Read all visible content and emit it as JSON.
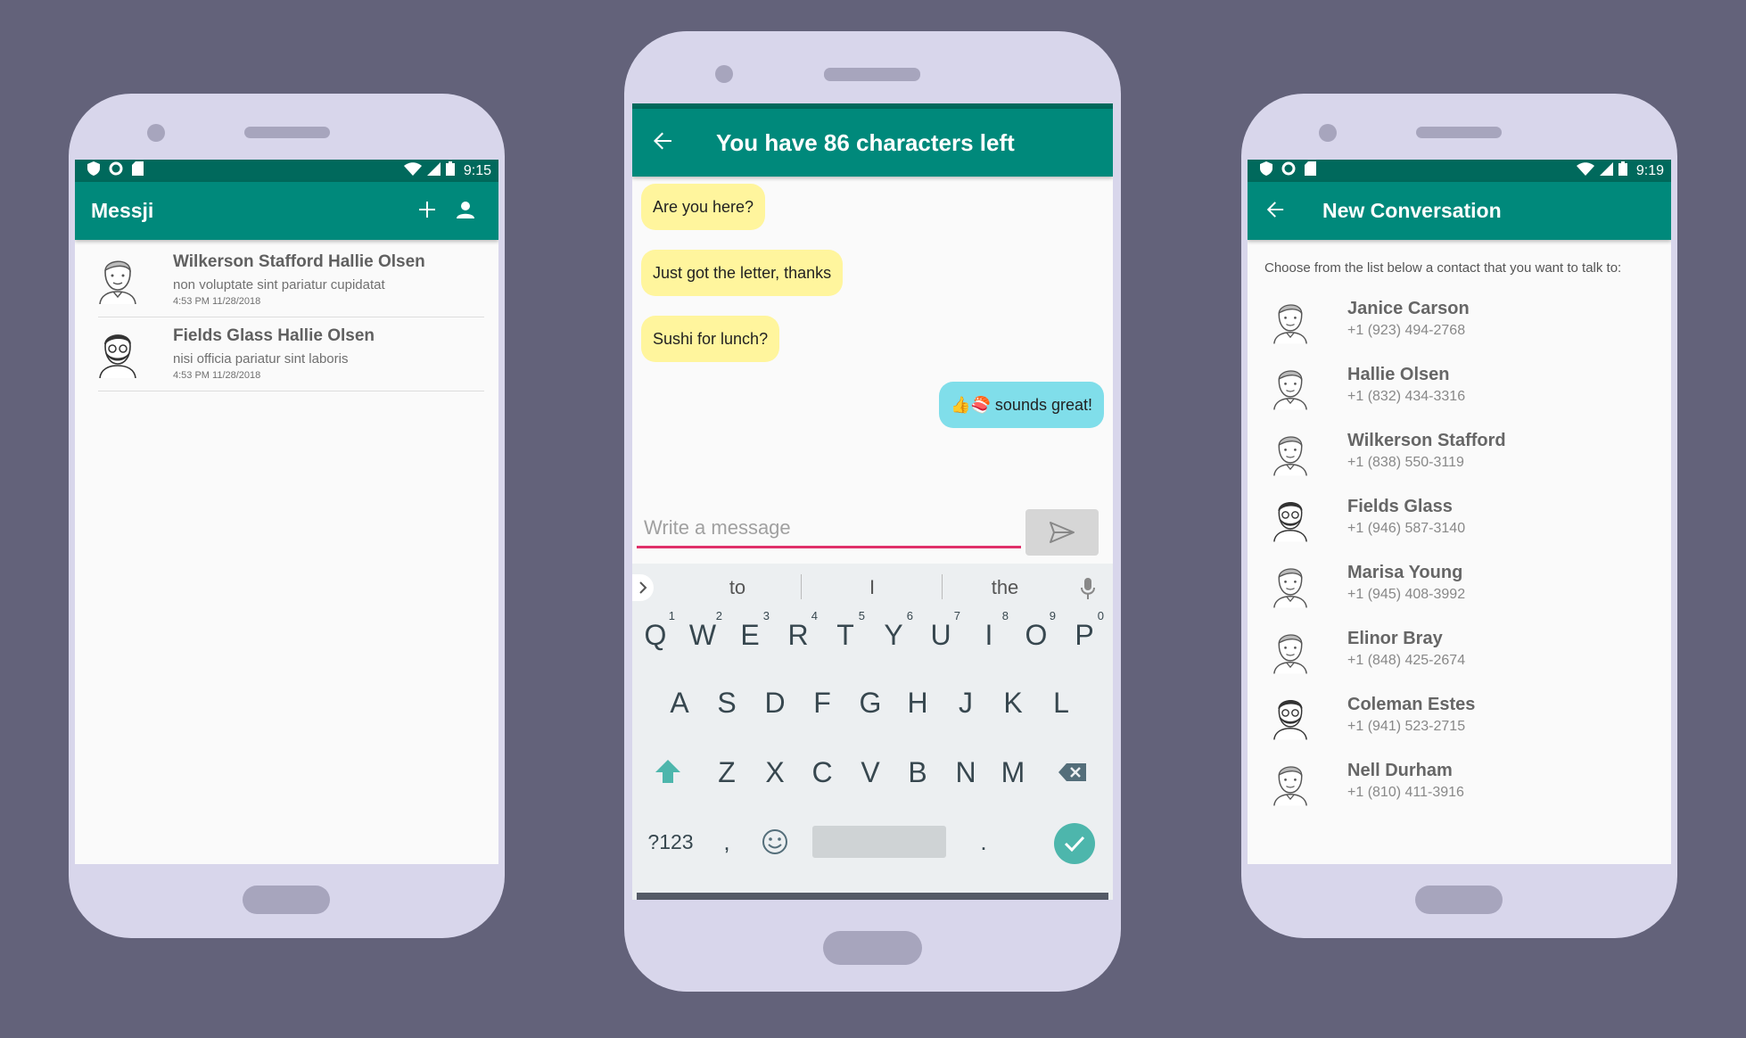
{
  "phone1": {
    "status_time": "9:15",
    "app_title": "Messji",
    "conversations": [
      {
        "name": "Wilkerson Stafford Hallie Olsen",
        "snippet": "non voluptate sint pariatur cupidatat",
        "time": "4:53 PM 11/28/2018"
      },
      {
        "name": "Fields Glass Hallie Olsen",
        "snippet": "nisi officia pariatur sint laboris",
        "time": "4:53 PM 11/28/2018"
      }
    ]
  },
  "phone2": {
    "title": "You have 86 characters left",
    "messages": [
      {
        "text": "Are you here?",
        "direction": "in"
      },
      {
        "text": "Just got the letter, thanks",
        "direction": "in"
      },
      {
        "text": "Sushi for lunch?",
        "direction": "in"
      },
      {
        "text": "👍🍣 sounds great!",
        "direction": "out"
      }
    ],
    "input_placeholder": "Write a message",
    "suggestions": [
      "to",
      "I",
      "the"
    ],
    "keyboard": {
      "row1": [
        "Q",
        "W",
        "E",
        "R",
        "T",
        "Y",
        "U",
        "I",
        "O",
        "P"
      ],
      "row1_nums": [
        "1",
        "2",
        "3",
        "4",
        "5",
        "6",
        "7",
        "8",
        "9",
        "0"
      ],
      "row2": [
        "A",
        "S",
        "D",
        "F",
        "G",
        "H",
        "J",
        "K",
        "L"
      ],
      "row3": [
        "Z",
        "X",
        "C",
        "V",
        "B",
        "N",
        "M"
      ],
      "symbols_label": "?123",
      "comma": ",",
      "period": "."
    }
  },
  "phone3": {
    "status_time": "9:19",
    "title": "New Conversation",
    "instruction": "Choose from the list below a contact that you want to talk to:",
    "contacts": [
      {
        "name": "Janice Carson",
        "phone": "+1 (923) 494-2768",
        "avatar": "man"
      },
      {
        "name": "Hallie Olsen",
        "phone": "+1 (832) 434-3316",
        "avatar": "man"
      },
      {
        "name": "Wilkerson Stafford",
        "phone": "+1 (838) 550-3119",
        "avatar": "man"
      },
      {
        "name": "Fields Glass",
        "phone": "+1 (946) 587-3140",
        "avatar": "bearded"
      },
      {
        "name": "Marisa Young",
        "phone": "+1 (945) 408-3992",
        "avatar": "man"
      },
      {
        "name": "Elinor Bray",
        "phone": "+1 (848) 425-2674",
        "avatar": "man"
      },
      {
        "name": "Coleman Estes",
        "phone": "+1 (941) 523-2715",
        "avatar": "bearded"
      },
      {
        "name": "Nell Durham",
        "phone": "+1 (810) 411-3916",
        "avatar": "man"
      }
    ]
  },
  "colors": {
    "background": "#63627a",
    "phone_body": "#d8d6eb",
    "app_bar": "#00897b",
    "status_bar": "#00695c",
    "bubble_in": "#fff59d",
    "bubble_out": "#80deea",
    "input_underline": "#e0306a",
    "accent_key": "#4db6ac"
  }
}
